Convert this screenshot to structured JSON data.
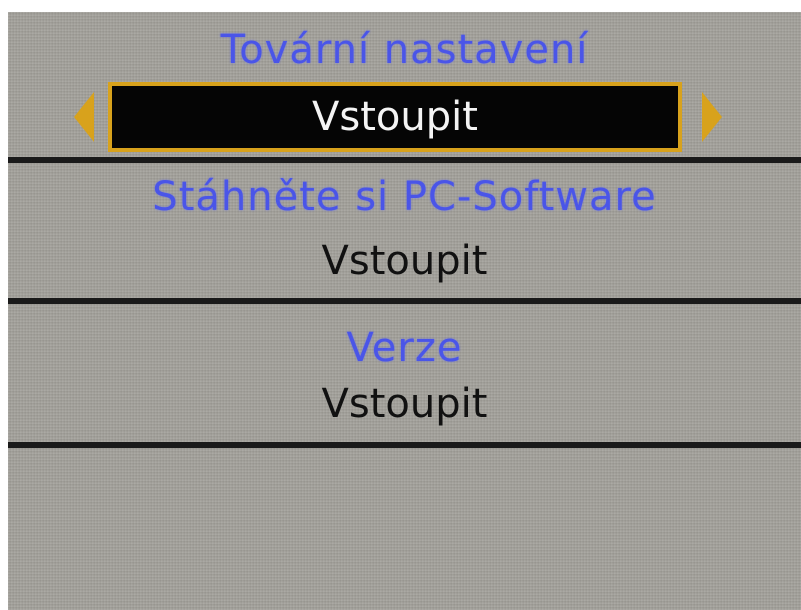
{
  "menu": {
    "items": [
      {
        "title": "Tovární nastavení",
        "value": "Vstoupit",
        "selected": true
      },
      {
        "title": "Stáhněte si PC-Software",
        "value": "Vstoupit",
        "selected": false
      },
      {
        "title": "Verze",
        "value": "Vstoupit",
        "selected": false
      }
    ]
  },
  "colors": {
    "background": "#a3a19b",
    "title_blue": "#4a55e8",
    "selection_border": "#d8a21c",
    "selection_fill": "#050505",
    "arrow": "#d8a21c"
  },
  "icons": {
    "left": "left-arrow-icon",
    "right": "right-arrow-icon"
  }
}
